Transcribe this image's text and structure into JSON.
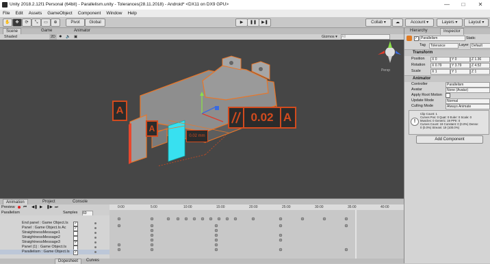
{
  "window": {
    "title": "Unity 2018.2.12f1 Personal (64bit) - Parallelism.unity - Tolerances(28.11.2018) - Android* <DX11 on DX9 GPU>",
    "minimize": "—",
    "maximize": "□",
    "close": "✕"
  },
  "menu": [
    "File",
    "Edit",
    "Assets",
    "GameObject",
    "Component",
    "Window",
    "Help"
  ],
  "toolbar": {
    "pivot": "Pivot",
    "global": "Global",
    "collab": "Collab ▾",
    "account": "Account ▾",
    "layers": "Layers ▾",
    "layout": "Layout ▾"
  },
  "scene": {
    "tabs": [
      "Scene",
      "Game",
      "Animator"
    ],
    "shading": "Shaded",
    "mode_2d": "2D",
    "gizmos": "Gizmos ▾",
    "search_placeholder": "All",
    "persp": "Persp"
  },
  "annotation": {
    "datum_left": "A",
    "datum_mid": "A",
    "dimension_label": "0.02 mm",
    "frame_value": "0.02",
    "frame_datum": "A"
  },
  "animation": {
    "tabs": [
      "Animation",
      "Project",
      "Console"
    ],
    "preview": "Preview",
    "clip": "Parallelism",
    "samples_label": "Samples",
    "samples_value": "60",
    "ticks": [
      "0:00",
      "5:00",
      "10:00",
      "15:00",
      "20:00",
      "25:00",
      "30:00",
      "35:00",
      "40:00"
    ],
    "properties": [
      {
        "label": "End panel : Game Object.Is",
        "checked": true
      },
      {
        "label": "Panel : Game Object.Is Ac",
        "checked": true
      },
      {
        "label": "StraightnessMessage1",
        "checked": false
      },
      {
        "label": "StraightnessMessage2",
        "checked": false
      },
      {
        "label": "StraightnessMessage3",
        "checked": true
      },
      {
        "label": "Panel (1) : Game Object.Is",
        "checked": false
      },
      {
        "label": "Parallelism : Game Object.Is",
        "checked": true
      }
    ],
    "bottom_tabs": [
      "Dopesheet",
      "Curves"
    ]
  },
  "inspector": {
    "tabs": [
      "Hierarchy",
      "Inspector"
    ],
    "object_name": "Parallelism",
    "static_label": "Static",
    "tag_label": "Tag",
    "tag_value": "Tolerance",
    "layer_label": "Layer",
    "layer_value": "Default",
    "transform": {
      "title": "Transform",
      "position_label": "Position",
      "rotation_label": "Rotation",
      "scale_label": "Scale",
      "position": [
        "X 0",
        "Y 0",
        "Z 1.36"
      ],
      "rotation": [
        "X 0.79",
        "Y 3.79",
        "Z 4.52"
      ],
      "scale": [
        "X 1",
        "Y 1",
        "Z 1"
      ]
    },
    "animator": {
      "title": "Animator",
      "controller_label": "Controller",
      "controller_value": "Parallelism",
      "avatar_label": "Avatar",
      "avatar_value": "None (Avatar)",
      "root_motion_label": "Apply Root Motion",
      "update_mode_label": "Update Mode",
      "update_mode_value": "Normal",
      "culling_label": "Culling Mode",
      "culling_value": "Always Animate"
    },
    "info_lines": [
      "Clip Count: 1",
      "Curves Pos: 0 Quat: 0 Euler: 0 Scale: 0",
      "Muscles: 0 Generic: 19 PPtr: 0",
      "Curves Count: 19 Constant: 0 (0.0%) Dense:",
      "0 (0.0%) Stream: 19 (100.0%)"
    ],
    "add_component": "Add Component"
  },
  "colors": {
    "viewport": "#464646",
    "part": "#8a8a8a",
    "outline": "#e8772a",
    "surface_red": "#e8482e",
    "surface_cyan": "#38e0f0",
    "annotation": "#d24b1e"
  }
}
